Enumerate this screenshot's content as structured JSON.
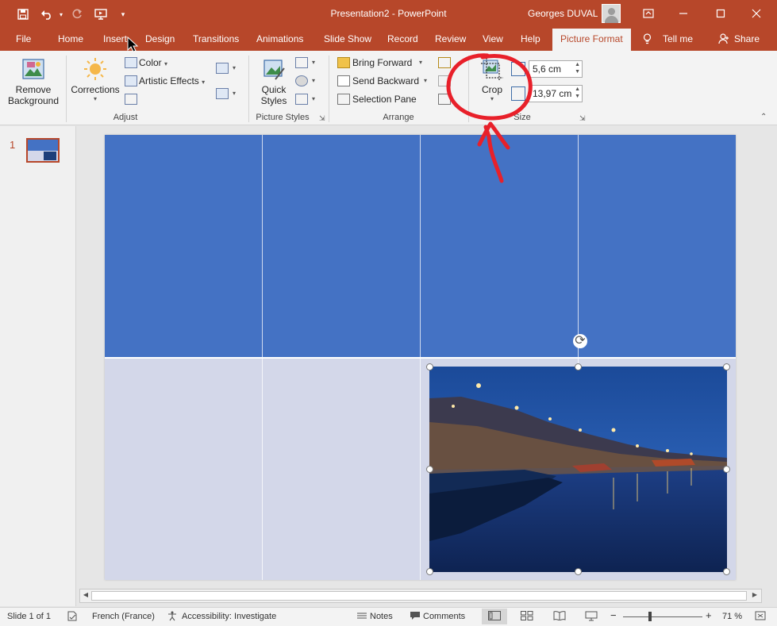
{
  "window": {
    "title": "Presentation2  -  PowerPoint",
    "user": "Georges DUVAL",
    "quick_access": [
      "save-icon",
      "undo-icon",
      "redo-icon",
      "present-icon",
      "customize-icon"
    ],
    "controls": [
      "ribbon-display-icon",
      "minimize-icon",
      "restore-icon",
      "close-icon"
    ]
  },
  "tabs": {
    "file": "File",
    "home": "Home",
    "insert": "Insert",
    "design": "Design",
    "transitions": "Transitions",
    "animations": "Animations",
    "slideshow": "Slide Show",
    "record": "Record",
    "review": "Review",
    "view": "View",
    "help": "Help",
    "picture_format": "Picture Format",
    "tell_me": "Tell me",
    "share": "Share"
  },
  "ribbon": {
    "remove_background_1": "Remove",
    "remove_background_2": "Background",
    "corrections": "Corrections",
    "color": "Color",
    "artistic_effects": "Artistic Effects",
    "adjust_label": "Adjust",
    "quick_styles_1": "Quick",
    "quick_styles_2": "Styles",
    "picture_styles_label": "Picture Styles",
    "bring_forward": "Bring Forward",
    "send_backward": "Send Backward",
    "selection_pane": "Selection Pane",
    "arrange_label": "Arrange",
    "crop": "Crop",
    "height": "5,6 cm",
    "width": "13,97 cm",
    "size_label": "Size"
  },
  "thumbnails": {
    "slide_number": "1"
  },
  "status": {
    "slide_info": "Slide 1 of 1",
    "language": "French (France)",
    "accessibility": "Accessibility: Investigate",
    "notes": "Notes",
    "comments": "Comments",
    "zoom": "71 %",
    "zoom_minus": "−",
    "zoom_plus": "+"
  },
  "colors": {
    "accent": "#b7472a",
    "slide_blue": "#4472c4",
    "annotation_red": "#e8202a"
  }
}
